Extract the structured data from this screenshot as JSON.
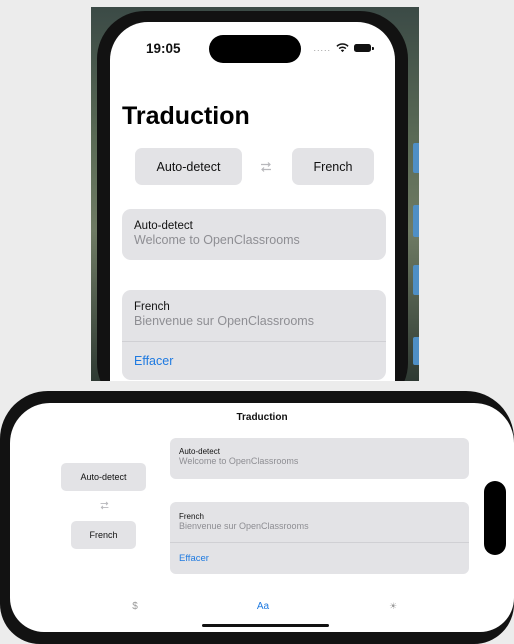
{
  "portrait": {
    "status": {
      "time": "19:05",
      "dots": "....."
    },
    "title": "Traduction",
    "source_language_button": "Auto-detect",
    "target_language_button": "French",
    "input_card": {
      "language": "Auto-detect",
      "text": "Welcome to OpenClassrooms"
    },
    "output_card": {
      "language": "French",
      "text": "Bienvenue sur OpenClassrooms",
      "clear_label": "Effacer"
    }
  },
  "landscape": {
    "nav_title": "Traduction",
    "source_language_button": "Auto-detect",
    "target_language_button": "French",
    "input_card": {
      "language": "Auto-detect",
      "text": "Welcome to OpenClassrooms"
    },
    "output_card": {
      "language": "French",
      "text": "Bienvenue sur OpenClassrooms",
      "clear_label": "Effacer"
    },
    "tabbar": [
      {
        "label": "$",
        "icon": "currency-tab-icon",
        "selected": false
      },
      {
        "label": "Aa",
        "icon": "translate-tab-icon",
        "selected": true
      },
      {
        "label": "☀",
        "icon": "weather-tab-icon",
        "selected": false
      }
    ]
  },
  "colors": {
    "accent": "#1f7ae0",
    "card": "#e3e3e6",
    "frame": "#121212"
  }
}
